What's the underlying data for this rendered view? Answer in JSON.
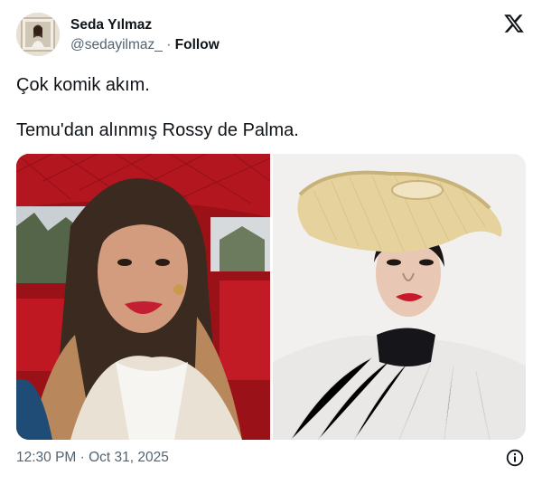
{
  "author": {
    "name": "Seda Yılmaz",
    "handle": "@sedayilmaz_",
    "separator": " · ",
    "follow_label": "Follow",
    "avatar_icon": "profile-photo"
  },
  "tweet": {
    "text_lines": [
      "Çok komik akım.",
      "Temu'dan alınmış Rossy de Palma."
    ]
  },
  "media": [
    {
      "description_icon": "photo-woman-in-car"
    },
    {
      "description_icon": "photo-woman-with-hat"
    }
  ],
  "footer": {
    "timestamp": "12:30 PM · Oct 31, 2025",
    "info_icon": "info-icon"
  },
  "colors": {
    "text": "#0f1419",
    "secondary": "#536471",
    "car_red": "#b0141c",
    "hat_beige": "#e9d9a8"
  }
}
